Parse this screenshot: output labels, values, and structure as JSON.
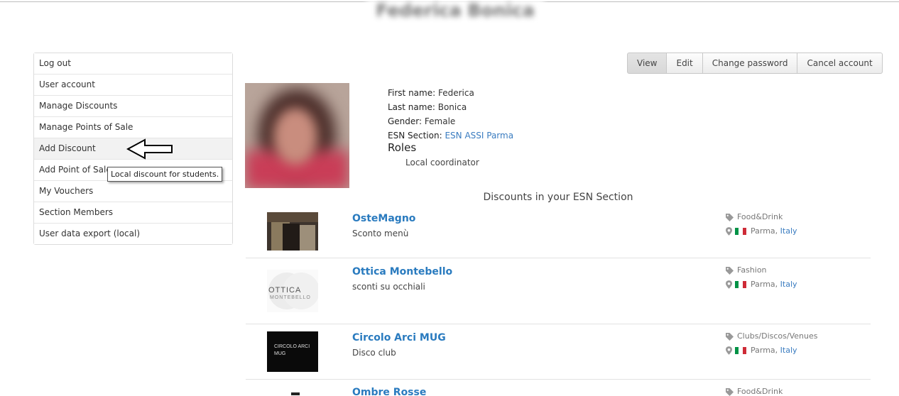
{
  "header": {
    "user_name": "Federica Bonica"
  },
  "sidebar": {
    "items": [
      {
        "label": "Log out"
      },
      {
        "label": "User account"
      },
      {
        "label": "Manage Discounts"
      },
      {
        "label": "Manage Points of Sale"
      },
      {
        "label": "Add Discount"
      },
      {
        "label": "Add Point of Sale"
      },
      {
        "label": "My Vouchers"
      },
      {
        "label": "Section Members"
      },
      {
        "label": "User data export (local)"
      }
    ],
    "tooltip": "Local discount for students."
  },
  "tabs": [
    {
      "label": "View"
    },
    {
      "label": "Edit"
    },
    {
      "label": "Change password"
    },
    {
      "label": "Cancel account"
    }
  ],
  "profile": {
    "first_name_label": "First name:",
    "first_name": "Federica",
    "last_name_label": "Last name:",
    "last_name": "Bonica",
    "gender_label": "Gender:",
    "gender": "Female",
    "section_label": "ESN Section:",
    "section": "ESN ASSI Parma",
    "roles_heading": "Roles",
    "role": "Local coordinator"
  },
  "discounts": {
    "heading": "Discounts in your ESN Section",
    "items": [
      {
        "title": "OsteMagno",
        "subtitle": "Sconto menù",
        "category": "Food&Drink",
        "city": "Parma",
        "country": "Italy"
      },
      {
        "title": "Ottica Montebello",
        "subtitle": "sconti su occhiali",
        "category": "Fashion",
        "city": "Parma",
        "country": "Italy",
        "logo_text_1": "OTTICA",
        "logo_text_2": "MONTEBELLO"
      },
      {
        "title": "Circolo Arci MUG",
        "subtitle": "Disco club",
        "category": "Clubs/Discos/Venues",
        "city": "Parma",
        "country": "Italy",
        "logo_text_1": "CIRCOLO ARCI",
        "logo_text_2": "MUG"
      },
      {
        "title": "Ombre Rosse",
        "category": "Food&Drink"
      }
    ]
  },
  "colors": {
    "link": "#2a7bbf",
    "flag_green": "#009246",
    "flag_white": "#ffffff",
    "flag_red": "#ce2b37"
  }
}
